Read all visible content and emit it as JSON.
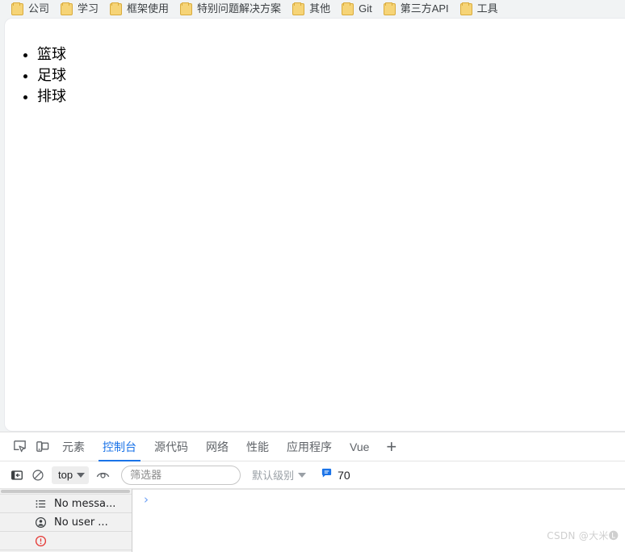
{
  "bookmarks_bar": {
    "items": [
      {
        "label": "公司",
        "icon": "folder-icon"
      },
      {
        "label": "学习",
        "icon": "folder-icon"
      },
      {
        "label": "框架使用",
        "icon": "folder-icon"
      },
      {
        "label": "特别问题解决方案",
        "icon": "folder-icon"
      },
      {
        "label": "其他",
        "icon": "folder-icon"
      },
      {
        "label": "Git",
        "icon": "folder-icon"
      },
      {
        "label": "第三方API",
        "icon": "folder-icon"
      },
      {
        "label": "工具",
        "icon": "folder-icon"
      }
    ]
  },
  "page": {
    "list_items": [
      {
        "text": "篮球"
      },
      {
        "text": "足球"
      },
      {
        "text": "排球"
      }
    ]
  },
  "devtools": {
    "inspect_icon": "inspect-element-icon",
    "device_toggle_icon": "device-toolbar-icon",
    "tabs": [
      {
        "label": "元素",
        "active": false
      },
      {
        "label": "控制台",
        "active": true
      },
      {
        "label": "源代码",
        "active": false
      },
      {
        "label": "网络",
        "active": false
      },
      {
        "label": "性能",
        "active": false
      },
      {
        "label": "应用程序",
        "active": false
      },
      {
        "label": "Vue",
        "active": false
      }
    ],
    "more_tabs_label": "+",
    "accent_color": "#1a73e8",
    "console_toolbar": {
      "sidebar_toggle_icon": "sidebar-toggle-icon",
      "clear_icon": "clear-console-icon",
      "context_label": "top",
      "eye_icon": "live-expression-icon",
      "filter_placeholder": "筛选器",
      "filter_value": "",
      "level_label": "默认级别",
      "message_icon": "message-bubble-icon",
      "message_count": "70",
      "badge_color": "#1a73e8"
    },
    "console_sidebar": {
      "items": [
        {
          "label": "No messa...",
          "icon": "list-icon"
        },
        {
          "label": "No user ...",
          "icon": "user-message-icon"
        },
        {
          "label": "",
          "icon": "error-icon"
        }
      ]
    },
    "console_prompt": {
      "chevron": "›",
      "value": ""
    }
  },
  "watermark": {
    "text": "CSDN @大米🅛"
  }
}
